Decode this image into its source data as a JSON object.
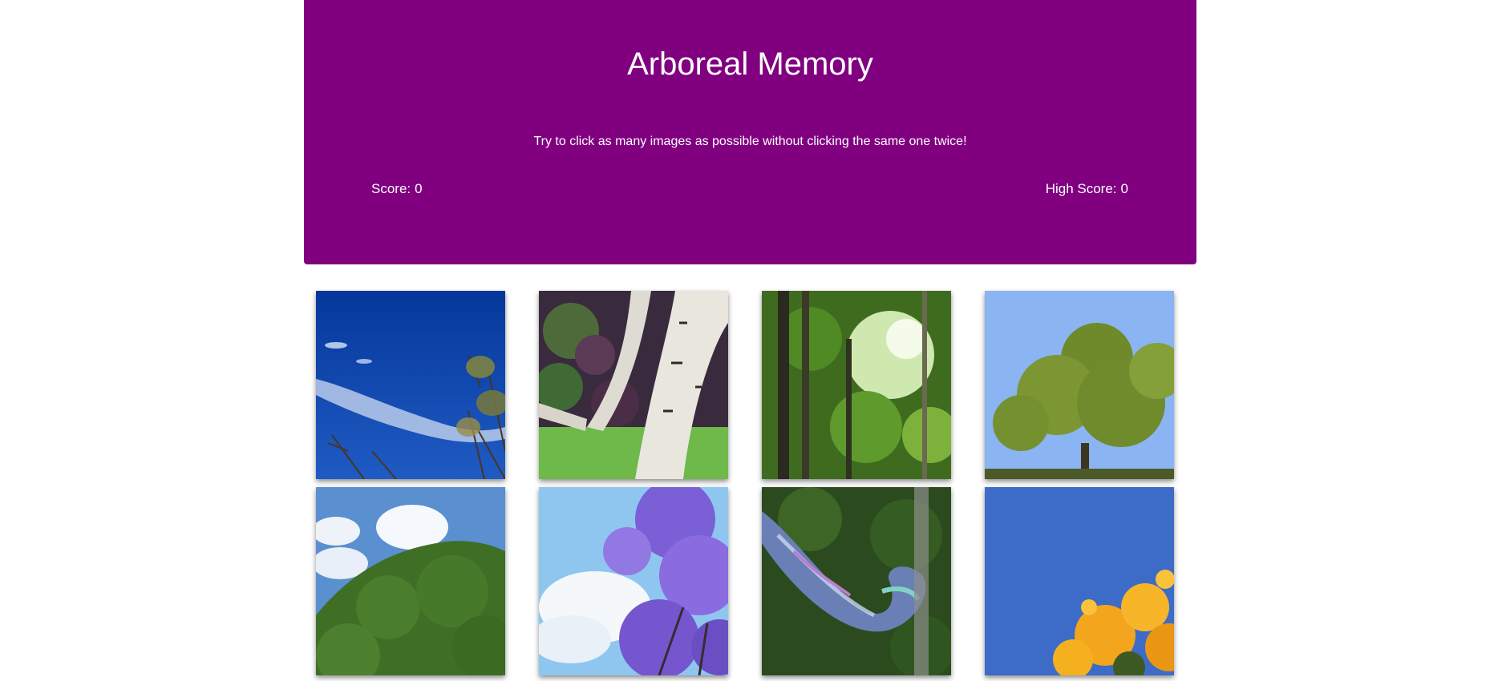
{
  "header": {
    "title": "Arboreal Memory",
    "instructions": "Try to click as many images as possible without clicking the same one twice!",
    "score_label": "Score:",
    "score_value": "0",
    "high_score_label": "High Score:",
    "high_score_value": "0"
  },
  "colors": {
    "header_bg": "#800080",
    "header_text": "#ffffff"
  },
  "cards": [
    {
      "id": "card-1",
      "image": "sky-with-bare-branches"
    },
    {
      "id": "card-2",
      "image": "white-birch-trunk"
    },
    {
      "id": "card-3",
      "image": "green-forest"
    },
    {
      "id": "card-4",
      "image": "tree-under-blue-sky"
    },
    {
      "id": "card-5",
      "image": "dense-green-canopy-with-clouds"
    },
    {
      "id": "card-6",
      "image": "purple-jacaranda"
    },
    {
      "id": "card-7",
      "image": "iridescent-sculpture-in-garden"
    },
    {
      "id": "card-8",
      "image": "yellow-flowers-blue-sky"
    }
  ]
}
